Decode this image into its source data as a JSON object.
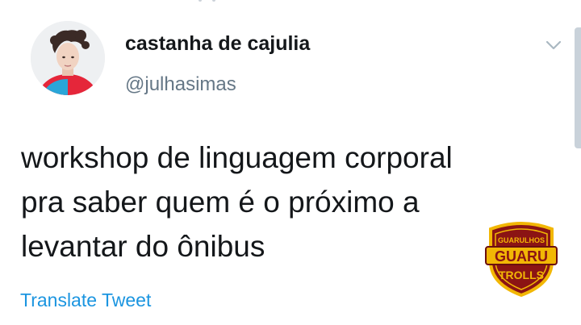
{
  "tweet": {
    "author": {
      "display_name": "castanha de cajulia",
      "handle": "@julhasimas"
    },
    "text_lines": [
      "workshop de linguagem corporal",
      "pra saber quem é o próximo a",
      "levantar do ônibus"
    ],
    "translate_label": "Translate Tweet",
    "menu_icon": "chevron-down-icon"
  },
  "watermark": {
    "line1": "GUARULHOS",
    "line2": "GUARU",
    "line3": "TROLLS"
  },
  "colors": {
    "link": "#1b95e0",
    "secondary_text": "#657786",
    "primary_text": "#14171a",
    "watermark_red": "#8b1414",
    "watermark_gold": "#f2b705"
  }
}
